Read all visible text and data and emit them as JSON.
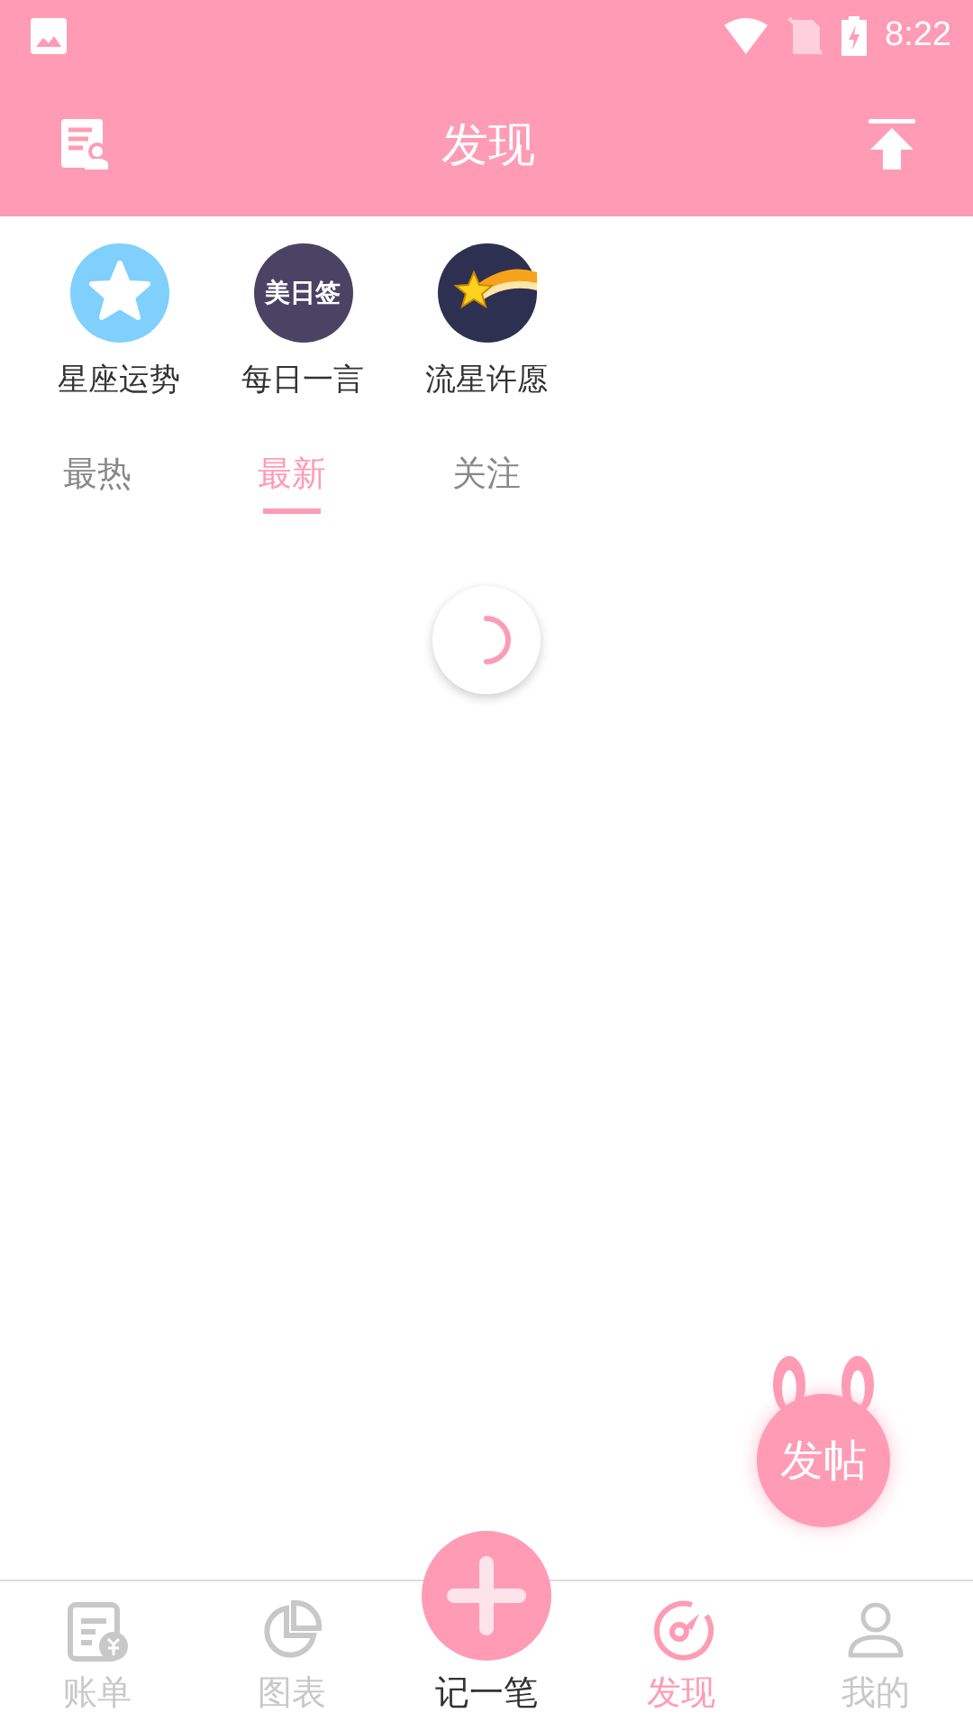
{
  "status_bar": {
    "time": "8:22"
  },
  "header": {
    "title": "发现"
  },
  "shortcuts": [
    {
      "kind": "star",
      "label": "星座运势"
    },
    {
      "kind": "text",
      "logo_text": "美日签",
      "label": "每日一言"
    },
    {
      "kind": "meteor",
      "label": "流星许愿"
    }
  ],
  "tabs": [
    {
      "label": "最热",
      "selected": false
    },
    {
      "label": "最新",
      "selected": true
    },
    {
      "label": "关注",
      "selected": false
    }
  ],
  "loading": true,
  "fab": {
    "label": "发帖"
  },
  "bottom_nav": [
    {
      "kind": "bill",
      "label": "账单",
      "selected": false
    },
    {
      "kind": "chart",
      "label": "图表",
      "selected": false
    },
    {
      "kind": "add",
      "label": "记一笔",
      "selected": false
    },
    {
      "kind": "discover",
      "label": "发现",
      "selected": true
    },
    {
      "kind": "profile",
      "label": "我的",
      "selected": false
    }
  ]
}
